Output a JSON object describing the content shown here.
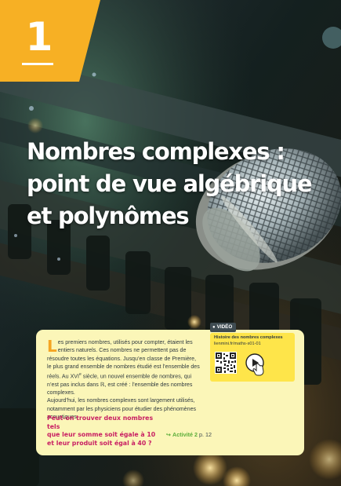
{
  "chapter": {
    "number": "1",
    "color": "#f7b024"
  },
  "title": {
    "lines": [
      "Nombres complexes :",
      "point de vue algébrique",
      "et polynômes"
    ]
  },
  "intro": {
    "dropcap": "L",
    "text_part1": "es premiers nombres, utilisés pour compter, étaient les entiers naturels. Ces nombres ne permettent pas de résoudre toutes les équations. Jusqu’en classe de Première, le plus grand ensemble de nombres étudié est l’ensemble des réels. Au XVI",
    "sup": "e",
    "text_part2": " siècle, un nouvel ensemble de nombres, qui n’est pas inclus dans ℝ, est créé : l’ensemble des nombres complexes.",
    "text_para2": "Aujourd’hui, les nombres complexes sont largement utilisés, notamment par les physiciens pour étudier des phénomènes acoustiques."
  },
  "question": {
    "lines": [
      "Peut-on trouver deux nombres tels",
      "que leur somme soit égale à 10",
      "et leur produit soit égal à 40 ?"
    ],
    "color": "#c81f63"
  },
  "activity": {
    "arrow": "↪",
    "name": "Activité 2",
    "page": "p. 12"
  },
  "video": {
    "tag": "VIDÉO",
    "title": "Histoire des nombres complexes",
    "url": "lienmini.fr/maths-s01-01",
    "qr_icon": "qr-code-icon",
    "play_icon": "play-button-hand-icon"
  },
  "colors": {
    "card_bg": "#fbf6b8",
    "video_bg": "#fee54a",
    "accent_green": "#5cae3a"
  }
}
